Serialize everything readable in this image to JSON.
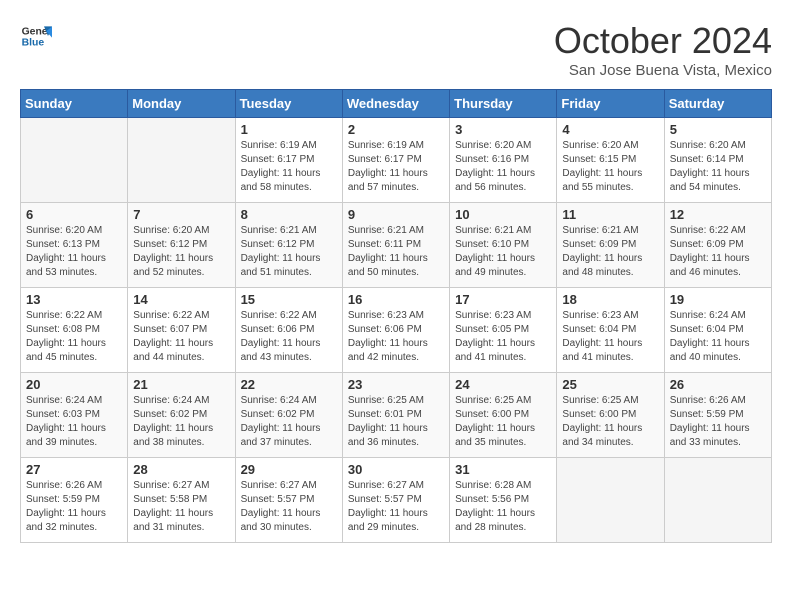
{
  "header": {
    "logo_line1": "General",
    "logo_line2": "Blue",
    "month": "October 2024",
    "location": "San Jose Buena Vista, Mexico"
  },
  "days_of_week": [
    "Sunday",
    "Monday",
    "Tuesday",
    "Wednesday",
    "Thursday",
    "Friday",
    "Saturday"
  ],
  "weeks": [
    [
      {
        "num": "",
        "info": "",
        "empty": true
      },
      {
        "num": "",
        "info": "",
        "empty": true
      },
      {
        "num": "1",
        "info": "Sunrise: 6:19 AM\nSunset: 6:17 PM\nDaylight: 11 hours and 58 minutes."
      },
      {
        "num": "2",
        "info": "Sunrise: 6:19 AM\nSunset: 6:17 PM\nDaylight: 11 hours and 57 minutes."
      },
      {
        "num": "3",
        "info": "Sunrise: 6:20 AM\nSunset: 6:16 PM\nDaylight: 11 hours and 56 minutes."
      },
      {
        "num": "4",
        "info": "Sunrise: 6:20 AM\nSunset: 6:15 PM\nDaylight: 11 hours and 55 minutes."
      },
      {
        "num": "5",
        "info": "Sunrise: 6:20 AM\nSunset: 6:14 PM\nDaylight: 11 hours and 54 minutes."
      }
    ],
    [
      {
        "num": "6",
        "info": "Sunrise: 6:20 AM\nSunset: 6:13 PM\nDaylight: 11 hours and 53 minutes."
      },
      {
        "num": "7",
        "info": "Sunrise: 6:20 AM\nSunset: 6:12 PM\nDaylight: 11 hours and 52 minutes."
      },
      {
        "num": "8",
        "info": "Sunrise: 6:21 AM\nSunset: 6:12 PM\nDaylight: 11 hours and 51 minutes."
      },
      {
        "num": "9",
        "info": "Sunrise: 6:21 AM\nSunset: 6:11 PM\nDaylight: 11 hours and 50 minutes."
      },
      {
        "num": "10",
        "info": "Sunrise: 6:21 AM\nSunset: 6:10 PM\nDaylight: 11 hours and 49 minutes."
      },
      {
        "num": "11",
        "info": "Sunrise: 6:21 AM\nSunset: 6:09 PM\nDaylight: 11 hours and 48 minutes."
      },
      {
        "num": "12",
        "info": "Sunrise: 6:22 AM\nSunset: 6:09 PM\nDaylight: 11 hours and 46 minutes."
      }
    ],
    [
      {
        "num": "13",
        "info": "Sunrise: 6:22 AM\nSunset: 6:08 PM\nDaylight: 11 hours and 45 minutes."
      },
      {
        "num": "14",
        "info": "Sunrise: 6:22 AM\nSunset: 6:07 PM\nDaylight: 11 hours and 44 minutes."
      },
      {
        "num": "15",
        "info": "Sunrise: 6:22 AM\nSunset: 6:06 PM\nDaylight: 11 hours and 43 minutes."
      },
      {
        "num": "16",
        "info": "Sunrise: 6:23 AM\nSunset: 6:06 PM\nDaylight: 11 hours and 42 minutes."
      },
      {
        "num": "17",
        "info": "Sunrise: 6:23 AM\nSunset: 6:05 PM\nDaylight: 11 hours and 41 minutes."
      },
      {
        "num": "18",
        "info": "Sunrise: 6:23 AM\nSunset: 6:04 PM\nDaylight: 11 hours and 41 minutes."
      },
      {
        "num": "19",
        "info": "Sunrise: 6:24 AM\nSunset: 6:04 PM\nDaylight: 11 hours and 40 minutes."
      }
    ],
    [
      {
        "num": "20",
        "info": "Sunrise: 6:24 AM\nSunset: 6:03 PM\nDaylight: 11 hours and 39 minutes."
      },
      {
        "num": "21",
        "info": "Sunrise: 6:24 AM\nSunset: 6:02 PM\nDaylight: 11 hours and 38 minutes."
      },
      {
        "num": "22",
        "info": "Sunrise: 6:24 AM\nSunset: 6:02 PM\nDaylight: 11 hours and 37 minutes."
      },
      {
        "num": "23",
        "info": "Sunrise: 6:25 AM\nSunset: 6:01 PM\nDaylight: 11 hours and 36 minutes."
      },
      {
        "num": "24",
        "info": "Sunrise: 6:25 AM\nSunset: 6:00 PM\nDaylight: 11 hours and 35 minutes."
      },
      {
        "num": "25",
        "info": "Sunrise: 6:25 AM\nSunset: 6:00 PM\nDaylight: 11 hours and 34 minutes."
      },
      {
        "num": "26",
        "info": "Sunrise: 6:26 AM\nSunset: 5:59 PM\nDaylight: 11 hours and 33 minutes."
      }
    ],
    [
      {
        "num": "27",
        "info": "Sunrise: 6:26 AM\nSunset: 5:59 PM\nDaylight: 11 hours and 32 minutes."
      },
      {
        "num": "28",
        "info": "Sunrise: 6:27 AM\nSunset: 5:58 PM\nDaylight: 11 hours and 31 minutes."
      },
      {
        "num": "29",
        "info": "Sunrise: 6:27 AM\nSunset: 5:57 PM\nDaylight: 11 hours and 30 minutes."
      },
      {
        "num": "30",
        "info": "Sunrise: 6:27 AM\nSunset: 5:57 PM\nDaylight: 11 hours and 29 minutes."
      },
      {
        "num": "31",
        "info": "Sunrise: 6:28 AM\nSunset: 5:56 PM\nDaylight: 11 hours and 28 minutes."
      },
      {
        "num": "",
        "info": "",
        "empty": true
      },
      {
        "num": "",
        "info": "",
        "empty": true
      }
    ]
  ]
}
